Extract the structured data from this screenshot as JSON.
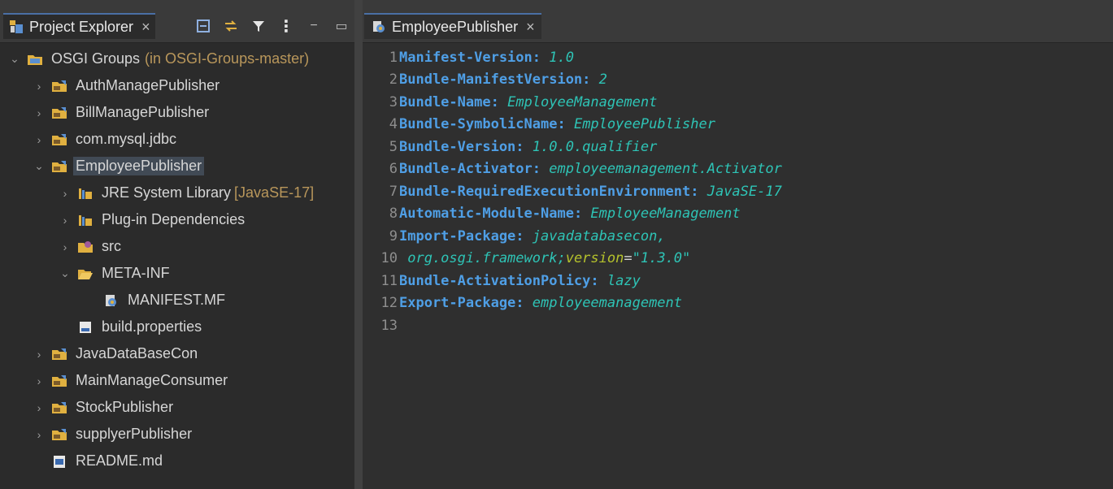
{
  "explorer": {
    "tab_title": "Project Explorer",
    "tab_close": "×",
    "toolbar_icons": [
      "collapse-all-icon",
      "link-with-editor-icon",
      "filter-icon",
      "view-menu-icon",
      "minimize-icon",
      "maximize-icon"
    ],
    "menu_glyph": "⋮",
    "minimize_glyph": "−",
    "maximize_glyph": "▭",
    "root": {
      "label": "OSGI Groups",
      "decoration": "(in OSGI-Groups-master)"
    },
    "projects": [
      {
        "label": "AuthManagePublisher"
      },
      {
        "label": "BillManagePublisher"
      },
      {
        "label": "com.mysql.jdbc"
      },
      {
        "label": "EmployeePublisher"
      },
      {
        "label": "JavaDataBaseCon"
      },
      {
        "label": "MainManageConsumer"
      },
      {
        "label": "StockPublisher"
      },
      {
        "label": "supplyerPublisher"
      }
    ],
    "employee_children": {
      "jre": {
        "label": "JRE System Library",
        "decoration": "[JavaSE-17]"
      },
      "plugins": {
        "label": "Plug-in Dependencies"
      },
      "src": {
        "label": "src"
      },
      "meta_inf": {
        "label": "META-INF"
      },
      "manifest": {
        "label": "MANIFEST.MF"
      },
      "build": {
        "label": "build.properties"
      }
    },
    "readme": {
      "label": "README.md"
    },
    "colors": {
      "selection": "#414a55",
      "decoration": "#b9975b"
    }
  },
  "editor": {
    "tab_title": "EmployeePublisher",
    "tab_close": "×",
    "colors": {
      "key": "#4f9fe6",
      "value": "#2ec4b6",
      "attribute": "#b5c22c"
    },
    "lines": [
      {
        "num": "1",
        "key": "Manifest-Version",
        "value": "1.0"
      },
      {
        "num": "2",
        "key": "Bundle-ManifestVersion",
        "value": "2"
      },
      {
        "num": "3",
        "key": "Bundle-Name",
        "value": "EmployeeManagement"
      },
      {
        "num": "4",
        "key": "Bundle-SymbolicName",
        "value": "EmployeePublisher"
      },
      {
        "num": "5",
        "key": "Bundle-Version",
        "value": "1.0.0.qualifier"
      },
      {
        "num": "6",
        "key": "Bundle-Activator",
        "value": "employeemanagement.Activator"
      },
      {
        "num": "7",
        "key": "Bundle-RequiredExecutionEnvironment",
        "value": "JavaSE-17"
      },
      {
        "num": "8",
        "key": "Automatic-Module-Name",
        "value": "EmployeeManagement"
      },
      {
        "num": "9",
        "key": "Import-Package",
        "value": "javadatabasecon,"
      },
      {
        "num": "10",
        "cont": " org.osgi.framework;",
        "attr": "version",
        "eq": "=",
        "str": "\"1.3.0\""
      },
      {
        "num": "11",
        "key": "Bundle-ActivationPolicy",
        "value": "lazy"
      },
      {
        "num": "12",
        "key": "Export-Package",
        "value": "employeemanagement"
      },
      {
        "num": "13"
      }
    ]
  }
}
